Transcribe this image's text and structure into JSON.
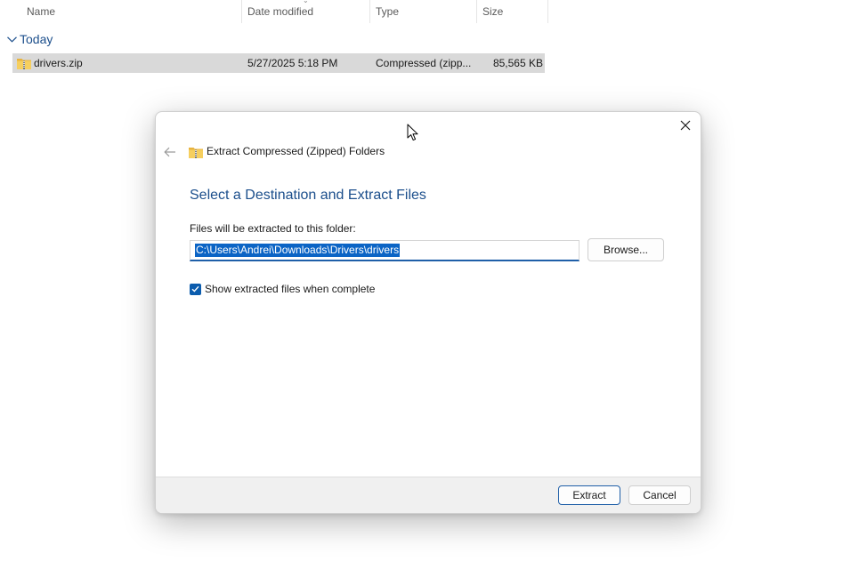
{
  "explorer": {
    "columns": {
      "name": "Name",
      "date_modified": "Date modified",
      "type": "Type",
      "size": "Size"
    },
    "group": {
      "title": "Today",
      "icon": "chevron-down-icon"
    },
    "files": [
      {
        "name": "drivers.zip",
        "date_modified": "5/27/2025 5:18 PM",
        "type": "Compressed (zipp...",
        "size": "85,565 KB",
        "icon": "zip-folder-icon"
      }
    ]
  },
  "dialog": {
    "title": "Extract Compressed (Zipped) Folders",
    "heading": "Select a Destination and Extract Files",
    "destination_label": "Files will be extracted to this folder:",
    "destination_value": "C:\\Users\\Andrei\\Downloads\\Drivers\\drivers",
    "browse_label": "Browse...",
    "show_files_label": "Show extracted files when complete",
    "show_files_checked": true,
    "extract_label": "Extract",
    "cancel_label": "Cancel",
    "icons": {
      "back": "back-arrow-icon",
      "close": "close-icon",
      "title": "zip-folder-icon"
    }
  },
  "colors": {
    "accent": "#0b5cad",
    "heading": "#1c4f8c",
    "selection": "#0b64c5",
    "row_selected": "#d9d9d9",
    "footer": "#f0f0f0"
  }
}
